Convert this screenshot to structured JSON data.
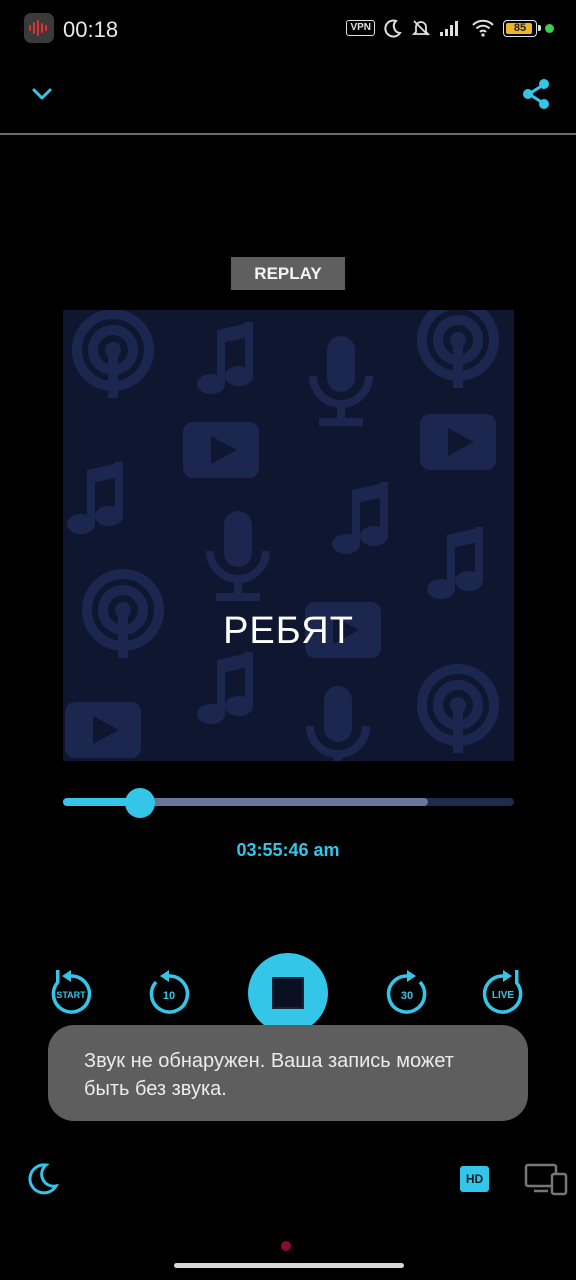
{
  "status_bar": {
    "time": "00:18",
    "vpn_label": "VPN",
    "battery_level": "85",
    "icons": [
      "recorder-app-icon",
      "vpn-icon",
      "moon-icon",
      "bell-muted-icon",
      "signal-icon",
      "wifi-icon",
      "battery-icon",
      "privacy-dot-icon"
    ]
  },
  "app_bar": {
    "back_icon": "chevron-down-icon",
    "share_icon": "share-icon"
  },
  "player": {
    "replay_label": "REPLAY",
    "subtitle": "РЕБЯТ",
    "time": "03:55:46 am",
    "progress_played": 0.17,
    "progress_buffered": 0.81
  },
  "controls": {
    "start_label": "START",
    "back_label": "10",
    "forward_label": "30",
    "live_label": "LIVE",
    "stop_icon": "stop-icon"
  },
  "toast": {
    "message": "Звук не обнаружен. Ваша запись может быть без звука."
  },
  "bottom_bar": {
    "hd_label": "HD",
    "icons": [
      "moon-icon",
      "hd-icon",
      "cast-icon"
    ]
  },
  "colors": {
    "accent": "#33c6e8",
    "background": "#000000",
    "artwork_bg": "#0f1630",
    "artwork_pattern": "#1c2750",
    "toast_bg": "#5e5e5e",
    "replay_bg": "#5f5f5f",
    "battery_fill": "#f0b429"
  }
}
